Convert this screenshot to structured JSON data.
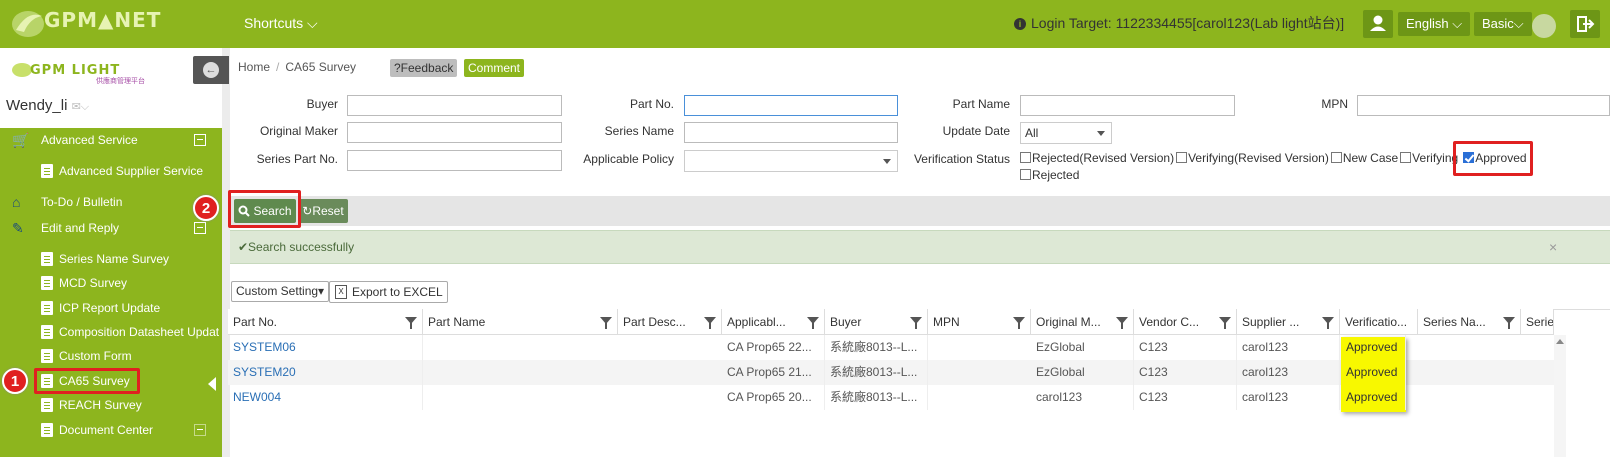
{
  "header": {
    "logo_text": "GPM▲NET",
    "shortcuts": "Shortcuts",
    "login_target": "Login Target: 1122334455[carol123(Lab light站台)]",
    "language": "English",
    "mode": "Basic"
  },
  "sidebar": {
    "logo_text": "GPM LIGHT",
    "logo_sub": "供應商管理平台",
    "user_name": "Wendy_li",
    "items": [
      {
        "label": "Advanced Service"
      },
      {
        "label": "Advanced Supplier Service"
      },
      {
        "label": "To-Do / Bulletin"
      },
      {
        "label": "Edit and Reply"
      },
      {
        "label": "Series Name Survey"
      },
      {
        "label": "MCD Survey"
      },
      {
        "label": "ICP Report Update"
      },
      {
        "label": "Composition Datasheet Updat"
      },
      {
        "label": "Custom Form"
      },
      {
        "label": "CA65 Survey"
      },
      {
        "label": "REACH Survey"
      },
      {
        "label": "Document Center"
      }
    ],
    "badge1": "1"
  },
  "breadcrumb": {
    "home": "Home",
    "sep": "/",
    "current": "CA65 Survey"
  },
  "buttons": {
    "feedback": "?Feedback",
    "comment": "Comment",
    "search": "Search",
    "reset": "Reset",
    "custom_setting": "Custom Setting",
    "export": "Export to EXCEL",
    "badge2": "2"
  },
  "form": {
    "buyer": "Buyer",
    "part_no": "Part No.",
    "part_name": "Part Name",
    "mpn": "MPN",
    "original_maker": "Original Maker",
    "series_name": "Series Name",
    "update_date": "Update Date",
    "update_date_value": "All",
    "series_part_no": "Series Part No.",
    "applicable_policy": "Applicable Policy",
    "verification_status": "Verification Status",
    "statuses": [
      {
        "label": "Rejected(Revised Version)",
        "checked": false
      },
      {
        "label": "Verifying(Revised Version)",
        "checked": false
      },
      {
        "label": "New Case",
        "checked": false
      },
      {
        "label": "Verifying",
        "checked": false
      },
      {
        "label": "Approved",
        "checked": true
      },
      {
        "label": "Rejected",
        "checked": false
      }
    ]
  },
  "message": {
    "success": "✔Search successfully",
    "close": "×"
  },
  "grid": {
    "columns": [
      "Part No.",
      "Part Name",
      "Part Desc...",
      "Applicabl...",
      "Buyer",
      "MPN",
      "Original M...",
      "Vendor C...",
      "Supplier ...",
      "Verificatio...",
      "Series Na...",
      "Serie"
    ],
    "rows": [
      {
        "part_no": "SYSTEM06",
        "policy": "CA Prop65 22...",
        "buyer": "系統廠8013--L...",
        "maker": "EzGlobal",
        "vendor": "C123",
        "supplier": "carol123",
        "status": "Approved"
      },
      {
        "part_no": "SYSTEM20",
        "policy": "CA Prop65 21...",
        "buyer": "系統廠8013--L...",
        "maker": "EzGlobal",
        "vendor": "C123",
        "supplier": "carol123",
        "status": "Approved"
      },
      {
        "part_no": "NEW004",
        "policy": "CA Prop65 20...",
        "buyer": "系統廠8013--L...",
        "maker": "carol123",
        "vendor": "C123",
        "supplier": "carol123",
        "status": "Approved"
      }
    ]
  }
}
